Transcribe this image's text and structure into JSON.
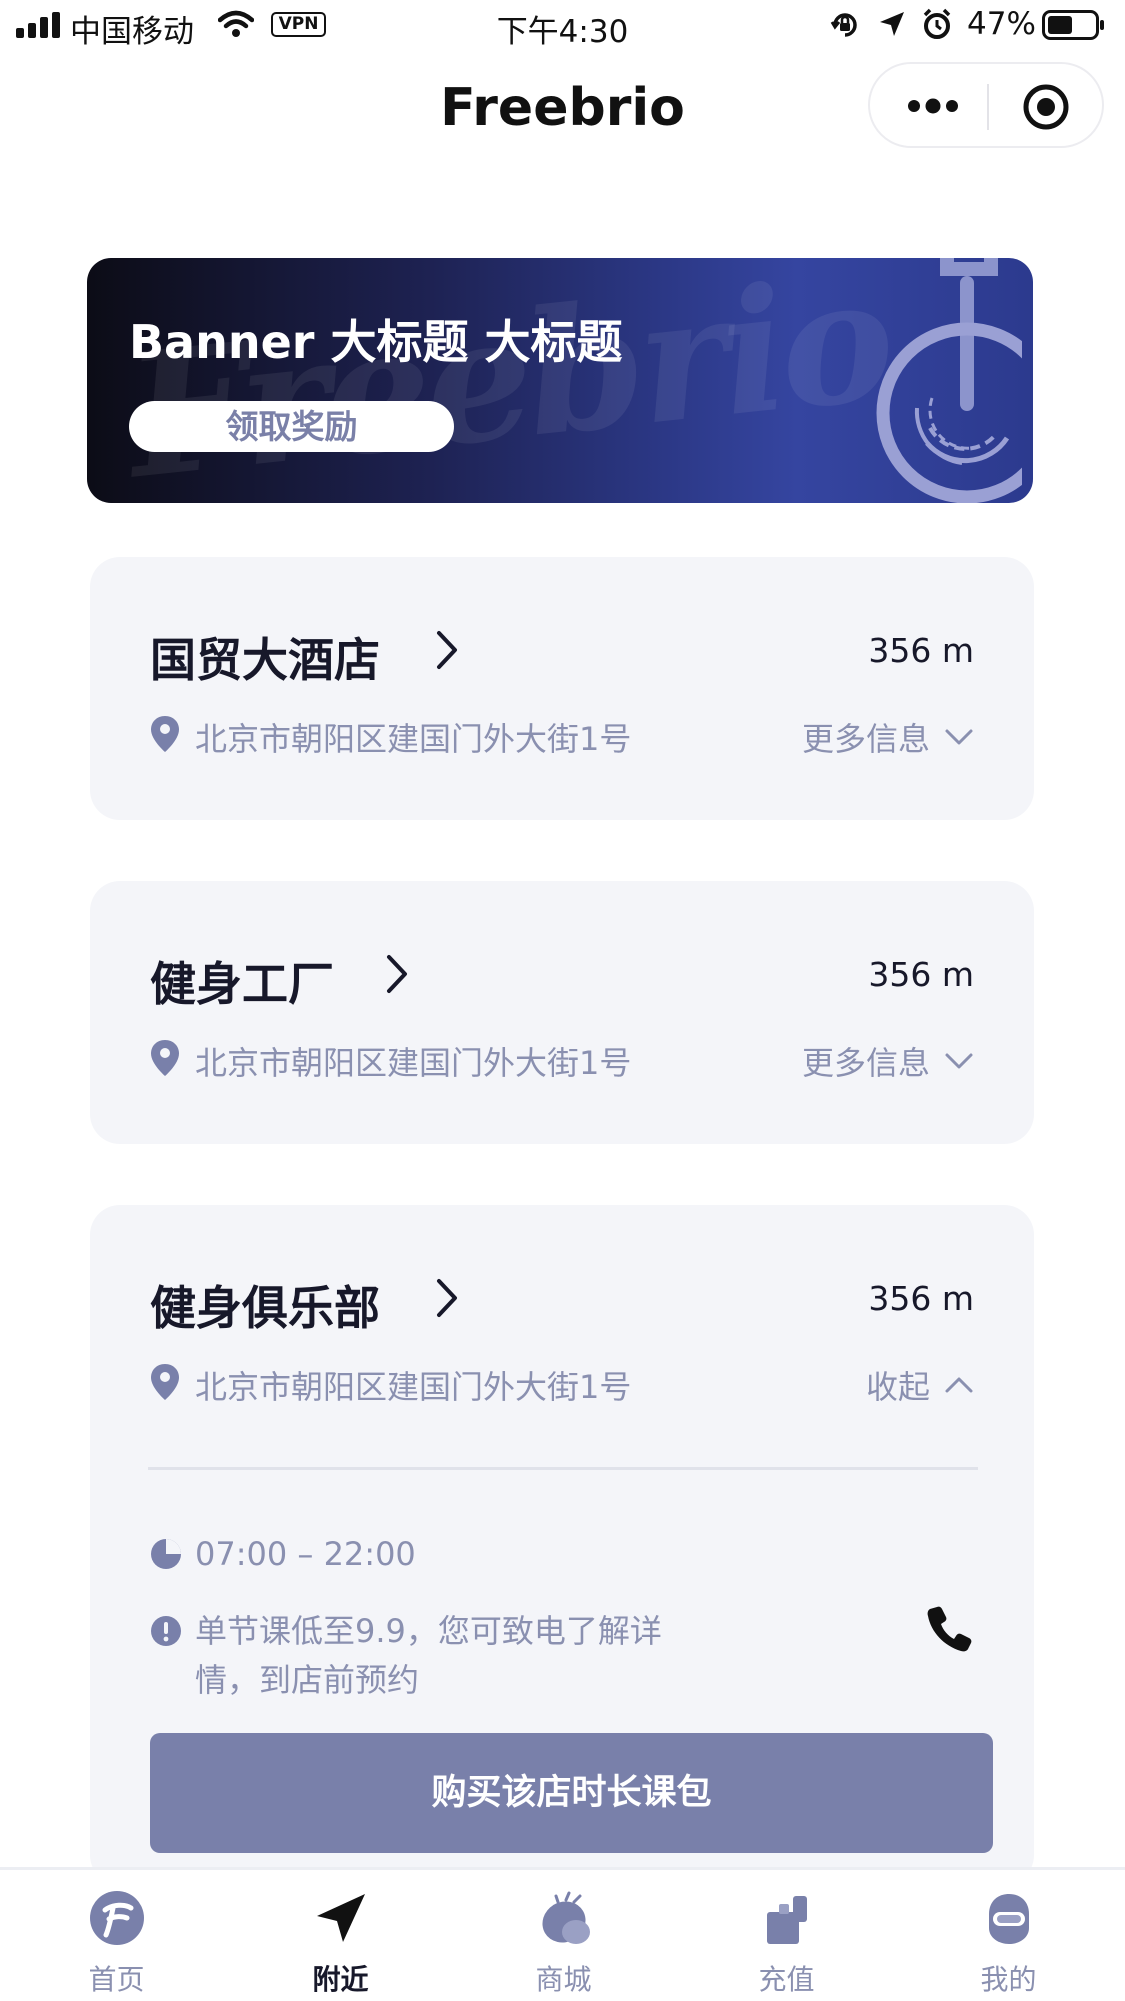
{
  "status_bar": {
    "carrier": "中国移动",
    "vpn": "VPN",
    "time": "下午4:30",
    "battery": "47%"
  },
  "nav": {
    "title": "Freebrio"
  },
  "banner": {
    "title": "Banner 大标题 大标题",
    "button_label": "领取奖励",
    "watermark": "Freebrio"
  },
  "stores": [
    {
      "name": "国贸大酒店",
      "distance": "356 m",
      "address": "北京市朝阳区建国门外大街1号",
      "toggle_label": "更多信息",
      "expanded": false
    },
    {
      "name": "健身工厂",
      "distance": "356 m",
      "address": "北京市朝阳区建国门外大街1号",
      "toggle_label": "更多信息",
      "expanded": false
    },
    {
      "name": "健身俱乐部",
      "distance": "356 m",
      "address": "北京市朝阳区建国门外大街1号",
      "toggle_label": "收起",
      "expanded": true,
      "hours": "07:00 – 22:00",
      "notice_line1": "单节课低至9.9，您可致电了解详",
      "notice_line2": "情，到店前预约",
      "buy_label": "购买该店时长课包"
    }
  ],
  "tabbar": {
    "items": [
      {
        "label": "首页",
        "icon": "home-logo-icon",
        "active": false
      },
      {
        "label": "附近",
        "icon": "navigation-arrow-icon",
        "active": true
      },
      {
        "label": "商城",
        "icon": "shop-bag-icon",
        "active": false
      },
      {
        "label": "充值",
        "icon": "recharge-card-icon",
        "active": false
      },
      {
        "label": "我的",
        "icon": "profile-avatar-icon",
        "active": false
      }
    ]
  },
  "colors": {
    "accent": "#7980aa",
    "card_bg": "#f4f5f9",
    "muted_text": "#8a90b0",
    "banner_dark": "#0c0c16",
    "banner_blue": "#3545a0"
  }
}
